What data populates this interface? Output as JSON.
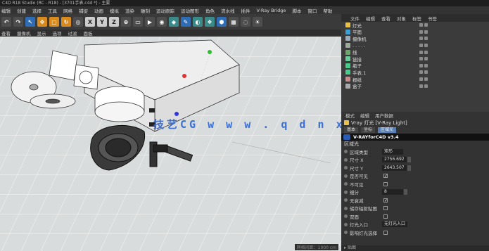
{
  "window": {
    "title": "C4D R18 Studio (RC - R18) - [3701手表.c4d *] - 主要"
  },
  "menubar": [
    "编辑",
    "创建",
    "选择",
    "工具",
    "网格",
    "捕捉",
    "动画",
    "模拟",
    "渲染",
    "雕刻",
    "运动跟踪",
    "运动图形",
    "角色",
    "流水线",
    "插件",
    "V-Ray Bridge",
    "脚本",
    "窗口",
    "帮助"
  ],
  "toolbar": {
    "buttons": [
      {
        "glyph": "↶",
        "icon": "undo-icon",
        "cls": ""
      },
      {
        "glyph": "↷",
        "icon": "redo-icon",
        "cls": ""
      },
      {
        "glyph": "↖",
        "icon": "select-icon",
        "cls": "blue"
      },
      {
        "glyph": "✥",
        "icon": "move-icon",
        "cls": "orange"
      },
      {
        "glyph": "▢",
        "icon": "scale-icon",
        "cls": "orange"
      },
      {
        "glyph": "↻",
        "icon": "rotate-icon",
        "cls": "orange"
      },
      {
        "glyph": "◎",
        "icon": "recent-icon",
        "cls": ""
      },
      {
        "glyph": "X",
        "icon": "x-axis-icon",
        "cls": "light"
      },
      {
        "glyph": "Y",
        "icon": "y-axis-icon",
        "cls": "light"
      },
      {
        "glyph": "Z",
        "icon": "z-axis-icon",
        "cls": "light"
      },
      {
        "glyph": "⊕",
        "icon": "world-icon",
        "cls": ""
      },
      {
        "glyph": "▭",
        "icon": "render-region-icon",
        "cls": ""
      },
      {
        "glyph": "▶",
        "icon": "render-view-icon",
        "cls": ""
      },
      {
        "glyph": "◉",
        "icon": "render-settings-icon",
        "cls": ""
      },
      {
        "glyph": "◆",
        "icon": "cube-icon",
        "cls": "teal"
      },
      {
        "glyph": "✎",
        "icon": "pen-icon",
        "cls": "blue"
      },
      {
        "glyph": "◐",
        "icon": "subdivision-icon",
        "cls": "teal"
      },
      {
        "glyph": "❖",
        "icon": "cloner-icon",
        "cls": "teal"
      },
      {
        "glyph": "⬢",
        "icon": "deformer-icon",
        "cls": "blue"
      },
      {
        "glyph": "▦",
        "icon": "floor-icon",
        "cls": ""
      },
      {
        "glyph": "◌",
        "icon": "camera-icon",
        "cls": ""
      },
      {
        "glyph": "☀",
        "icon": "light-icon",
        "cls": ""
      }
    ]
  },
  "viewport_menu": [
    "查看",
    "摄像机",
    "显示",
    "选项",
    "过滤",
    "面板"
  ],
  "watermark": "技艺CG  w w w . q d n x x f b . c o m",
  "status": "网格间距：1000 cm",
  "right_tabs": [
    "文件",
    "编辑",
    "查看",
    "对象",
    "标签",
    "书签"
  ],
  "objects": [
    {
      "name": "灯光",
      "color": "#e8c04a"
    },
    {
      "name": "平面",
      "color": "#3aa0d8"
    },
    {
      "name": "摄像机",
      "color": "#9ab"
    },
    {
      "name": ". . . . .",
      "color": "#9a9"
    },
    {
      "name": "线",
      "color": "#6a6"
    },
    {
      "name": "链接",
      "color": "#6c9"
    },
    {
      "name": "瓶子",
      "color": "#4c8"
    },
    {
      "name": "手表.1",
      "color": "#4c8"
    },
    {
      "name": "报纸",
      "color": "#c88"
    },
    {
      "name": "盒子",
      "color": "#aaa"
    }
  ],
  "attr": {
    "tabs": [
      "模式",
      "编辑",
      "用户数据"
    ],
    "title": "Vray 灯光 [V-Ray Light]",
    "subtabs": [
      "基本",
      "坐标",
      "区域光"
    ],
    "banner": "V-RAYforC4D  v3.4",
    "section": "区域光",
    "rows": [
      {
        "label": "区域类型",
        "value": "矩形",
        "type": "select"
      },
      {
        "label": "尺寸 X",
        "value": "2756.692",
        "type": "number"
      },
      {
        "label": "尺寸 Y",
        "value": "2643.507",
        "type": "number"
      },
      {
        "label": "是否可见",
        "value": "✓",
        "type": "check"
      },
      {
        "label": "不可见",
        "value": "",
        "type": "check"
      },
      {
        "label": "细分",
        "value": "8",
        "type": "number"
      },
      {
        "label": "无衰减",
        "value": "✓",
        "type": "check"
      },
      {
        "label": "储存辐射贴图",
        "value": "",
        "type": "check"
      },
      {
        "label": "双面",
        "value": "",
        "type": "check"
      },
      {
        "label": "灯光入口",
        "value": "无灯光入口",
        "type": "select"
      },
      {
        "label": "影响灯光选择",
        "value": "",
        "type": "check"
      }
    ],
    "footer": "▸ 贴图"
  }
}
